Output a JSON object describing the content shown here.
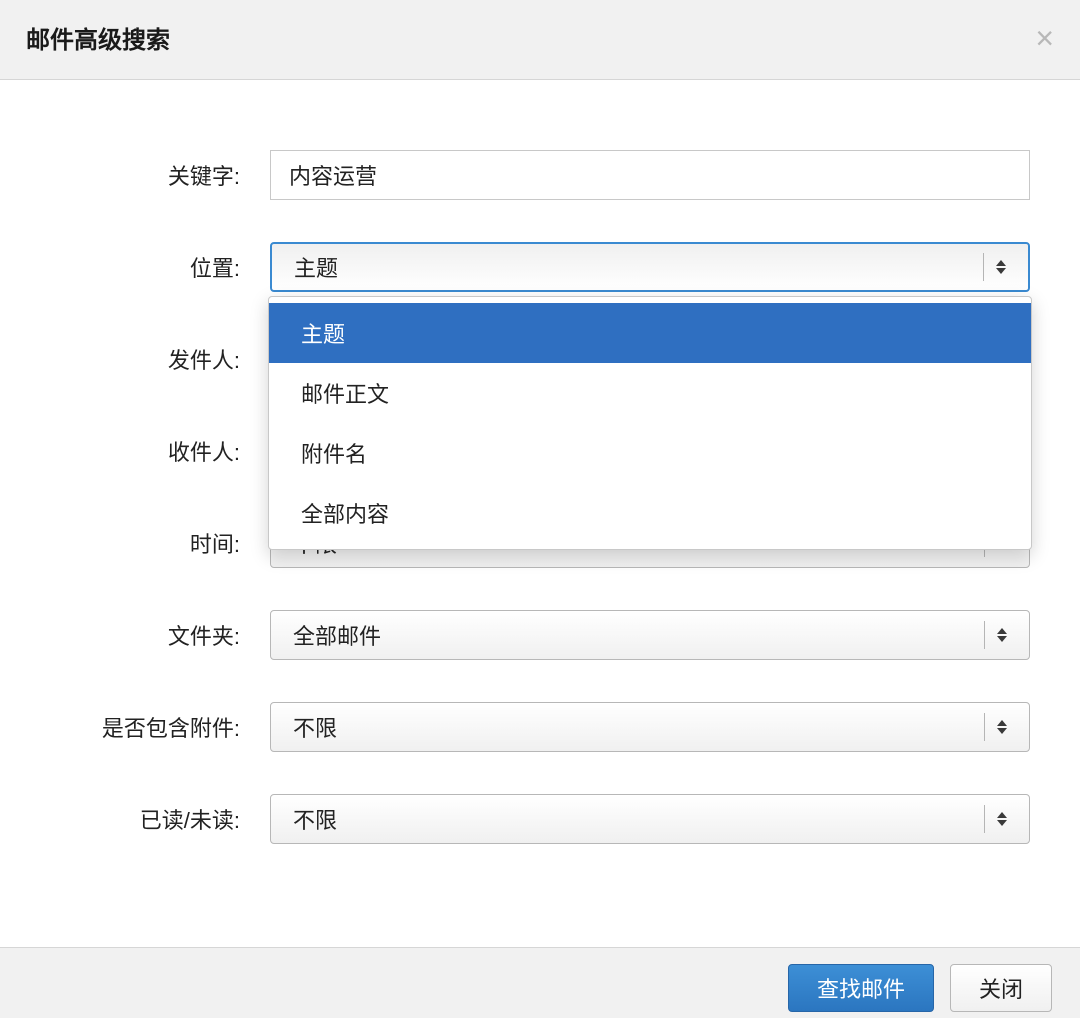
{
  "header": {
    "title": "邮件高级搜索"
  },
  "form": {
    "keyword": {
      "label": "关键字:",
      "value": "内容运营"
    },
    "location": {
      "label": "位置:",
      "value": "主题",
      "options": [
        "主题",
        "邮件正文",
        "附件名",
        "全部内容"
      ]
    },
    "sender": {
      "label": "发件人:",
      "value": ""
    },
    "recipient": {
      "label": "收件人:",
      "value": ""
    },
    "time": {
      "label": "时间:",
      "value": "不限"
    },
    "folder": {
      "label": "文件夹:",
      "value": "全部邮件"
    },
    "attachment": {
      "label": "是否包含附件:",
      "value": "不限"
    },
    "readstatus": {
      "label": "已读/未读:",
      "value": "不限"
    }
  },
  "footer": {
    "search": "查找邮件",
    "close": "关闭"
  }
}
